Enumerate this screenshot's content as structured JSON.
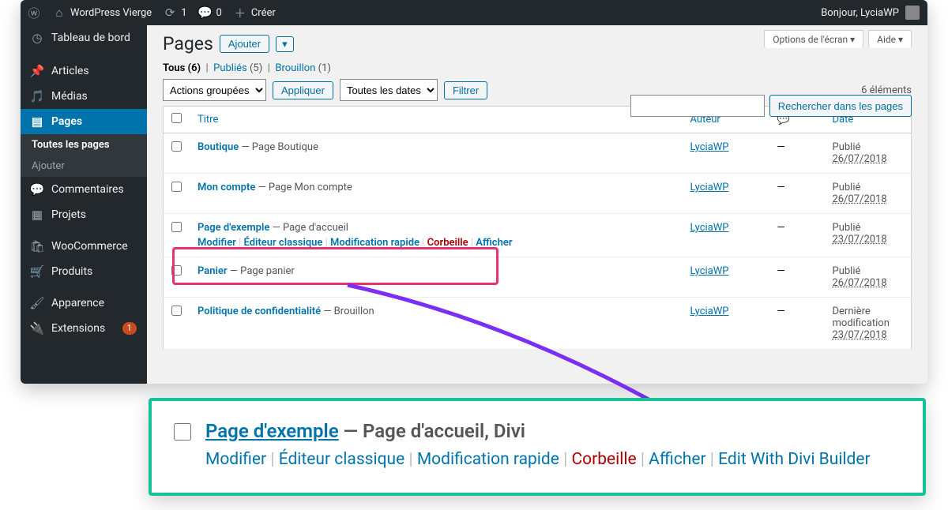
{
  "topbar": {
    "siteName": "WordPress Vierge",
    "updates": "1",
    "comments": "0",
    "create": "Créer",
    "greeting": "Bonjour, LyciaWP"
  },
  "sidebar": {
    "dashboard": "Tableau de bord",
    "posts": "Articles",
    "media": "Médias",
    "pages": "Pages",
    "pagesAll": "Toutes les pages",
    "pagesAdd": "Ajouter",
    "comments": "Commentaires",
    "projects": "Projets",
    "woocommerce": "WooCommerce",
    "products": "Produits",
    "appearance": "Apparence",
    "extensions": "Extensions",
    "extBadge": "1"
  },
  "page": {
    "title": "Pages",
    "addBtn": "Ajouter",
    "screenOpt": "Options de l'écran",
    "help": "Aide",
    "searchBtn": "Rechercher dans les pages",
    "countText": "6 éléments"
  },
  "filters": {
    "allLabel": "Tous",
    "allCount": "(6)",
    "pubLabel": "Publiés",
    "pubCount": "(5)",
    "draftLabel": "Brouillon",
    "draftCount": "(1)",
    "bulk": "Actions groupées",
    "apply": "Appliquer",
    "dates": "Toutes les dates",
    "filter": "Filtrer"
  },
  "cols": {
    "title": "Titre",
    "author": "Auteur",
    "date": "Date"
  },
  "actions": {
    "edit": "Modifier",
    "classic": "Éditeur classique",
    "quick": "Modification rapide",
    "trash": "Corbeille",
    "view": "Afficher",
    "divi": "Edit With Divi Builder"
  },
  "rows": [
    {
      "title": "Boutique",
      "state": "Page Boutique",
      "author": "LyciaWP",
      "comments": "—",
      "dateLabel": "Publié",
      "date": "26/07/2018"
    },
    {
      "title": "Mon compte",
      "state": "Page Mon compte",
      "author": "LyciaWP",
      "comments": "—",
      "dateLabel": "Publié",
      "date": "26/07/2018"
    },
    {
      "title": "Page d'exemple",
      "state": "Page d'accueil",
      "author": "LyciaWP",
      "comments": "—",
      "dateLabel": "Publié",
      "date": "23/07/2018",
      "hover": true
    },
    {
      "title": "Panier",
      "state": "Page panier",
      "author": "LyciaWP",
      "comments": "—",
      "dateLabel": "Publié",
      "date": "26/07/2018"
    },
    {
      "title": "Politique de confidentialité",
      "state": "Brouillon",
      "author": "LyciaWP",
      "comments": "—",
      "dateLabel": "Dernière modification",
      "date": "23/07/2018"
    }
  ],
  "zoom": {
    "title": "Page d'exemple",
    "state": "Page d'accueil, Divi"
  }
}
